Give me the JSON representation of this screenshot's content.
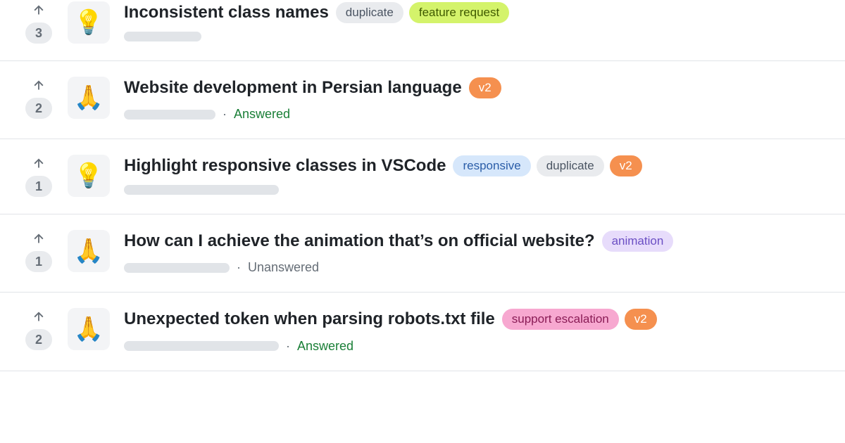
{
  "label_styles": {
    "duplicate": {
      "bg": "#e9ebee",
      "fg": "#4b5563"
    },
    "feature request": {
      "bg": "#d4f36b",
      "fg": "#3f5a00"
    },
    "v2": {
      "bg": "#f5904f",
      "fg": "#ffffff"
    },
    "responsive": {
      "bg": "#d6e7fb",
      "fg": "#2a5da8"
    },
    "animation": {
      "bg": "#e7dcfb",
      "fg": "#6b4fc4"
    },
    "support escalation": {
      "bg": "#f7a8d0",
      "fg": "#8a1c56"
    }
  },
  "status_text": {
    "answered": "Answered",
    "unanswered": "Unanswered"
  },
  "discussions": [
    {
      "votes": 3,
      "emoji": "💡",
      "title": "Inconsistent class names",
      "labels": [
        "duplicate",
        "feature request"
      ],
      "skeleton_width": 110,
      "status": null
    },
    {
      "votes": 2,
      "emoji": "🙏",
      "title": "Website development in Persian language",
      "labels": [
        "v2"
      ],
      "skeleton_width": 130,
      "status": "answered"
    },
    {
      "votes": 1,
      "emoji": "💡",
      "title": "Highlight responsive classes in VSCode",
      "labels": [
        "responsive",
        "duplicate",
        "v2"
      ],
      "skeleton_width": 220,
      "status": null
    },
    {
      "votes": 1,
      "emoji": "🙏",
      "title": "How can I achieve the animation that’s on official website?",
      "labels": [
        "animation"
      ],
      "skeleton_width": 150,
      "status": "unanswered"
    },
    {
      "votes": 2,
      "emoji": "🙏",
      "title": "Unexpected token when parsing robots.txt file",
      "labels": [
        "support escalation",
        "v2"
      ],
      "skeleton_width": 220,
      "status": "answered"
    }
  ]
}
